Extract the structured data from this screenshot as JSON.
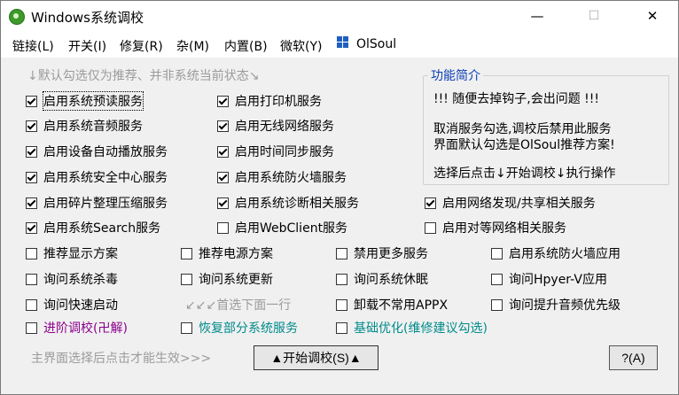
{
  "window": {
    "title": "Windows系统调校",
    "minimize_glyph": "—",
    "maximize_glyph": "☐",
    "close_glyph": "✕"
  },
  "menu": {
    "items": [
      "链接(L)",
      "开关(I)",
      "修复(R)",
      "杂(M)",
      "内置(B)",
      "微软(Y)"
    ],
    "brand": "OlSoul",
    "brand_icon": "windows-logo-icon"
  },
  "services_group": {
    "title": "↓默认勾选仅为推荐、并非系统当前状态↘",
    "items": [
      {
        "label": "启用系统预读服务",
        "checked": true
      },
      {
        "label": "启用打印机服务",
        "checked": true
      },
      {
        "label": "启用系统音频服务",
        "checked": true
      },
      {
        "label": "启用无线网络服务",
        "checked": true
      },
      {
        "label": "启用设备自动播放服务",
        "checked": true
      },
      {
        "label": "启用时间同步服务",
        "checked": true
      },
      {
        "label": "启用系统安全中心服务",
        "checked": true
      },
      {
        "label": "启用系统防火墙服务",
        "checked": true
      },
      {
        "label": "启用碎片整理压缩服务",
        "checked": true
      },
      {
        "label": "启用系统诊断相关服务",
        "checked": true
      },
      {
        "label": "启用网络发现/共享相关服务",
        "checked": true
      },
      {
        "label": "启用系统Search服务",
        "checked": true
      },
      {
        "label": "启用WebClient服务",
        "checked": false
      },
      {
        "label": "启用对等网络相关服务",
        "checked": false
      }
    ]
  },
  "intro": {
    "title": "功能简介",
    "line1": "!!! 随便去掉钩子,会出问题 !!!",
    "line2": "取消服务勾选,调校后禁用此服务",
    "line3": "界面默认勾选是OlSoul推荐方案!",
    "line4": "选择后点击↓开始调校↓执行操作"
  },
  "options": {
    "items": [
      {
        "label": "推荐显示方案",
        "checked": false
      },
      {
        "label": "推荐电源方案",
        "checked": false
      },
      {
        "label": "禁用更多服务",
        "checked": false
      },
      {
        "label": "启用系统防火墙应用",
        "checked": false
      },
      {
        "label": "询问系统杀毒",
        "checked": false
      },
      {
        "label": "询问系统更新",
        "checked": false
      },
      {
        "label": "询问系统休眠",
        "checked": false
      },
      {
        "label": "询问Hpyer-V应用",
        "checked": false
      },
      {
        "label": "询问快速启动",
        "checked": false
      },
      {
        "label": "卸载不常用APPX",
        "checked": false
      },
      {
        "label": "询问提升音频优先级",
        "checked": false
      }
    ],
    "hint": "↙↙↙首选下面一行"
  },
  "advanced": {
    "items": [
      {
        "label": "进阶调校(卍解)",
        "checked": false,
        "color": "#8b008b"
      },
      {
        "label": "恢复部分系统服务",
        "checked": false,
        "color": "#008b8b"
      },
      {
        "label": "基础优化(维修建议勾选)",
        "checked": false,
        "color": "#008b8b"
      }
    ]
  },
  "footer": {
    "hint": "主界面选择后点击才能生效>>>",
    "start_button": "▲开始调校(S)▲",
    "help_button": "?(A)"
  }
}
